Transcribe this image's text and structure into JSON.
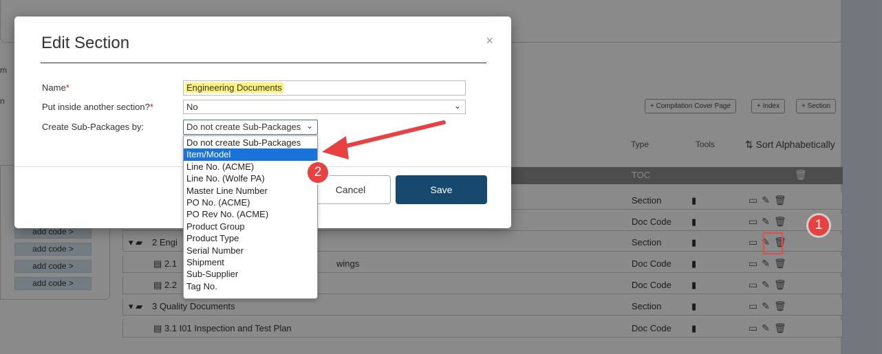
{
  "background": {
    "cut_labels": [
      "m",
      "n"
    ],
    "buttons": [
      "+ Compilation Cover Page",
      "+ Index",
      "+ Section"
    ],
    "table_headers": {
      "type": "Type",
      "tools": "Tools",
      "sort": "Sort Alphabetically"
    },
    "rows": [
      {
        "label": "",
        "type": "TOC"
      },
      {
        "label": "",
        "type": "Section"
      },
      {
        "label": "",
        "type": "Doc Code"
      },
      {
        "label": "2  Engi",
        "type": "Section"
      },
      {
        "label": "2.1",
        "label_tail": "wings",
        "type": "Doc Code"
      },
      {
        "label": "2.2",
        "type": "Doc Code"
      },
      {
        "label": "3  Quality Documents",
        "type": "Section"
      },
      {
        "label": "3.1  I01 Inspection and Test Plan",
        "type": "Doc Code"
      }
    ],
    "code_pills": [
      "add code >",
      "add code >",
      "add code >",
      "add code >"
    ]
  },
  "modal": {
    "title": "Edit Section",
    "close": "×",
    "fields": {
      "name_label": "Name",
      "name_value": "Engineering Documents",
      "parent_label": "Put inside another section?",
      "parent_value": "No",
      "sub_label": "Create Sub-Packages by:",
      "sub_value": "Do not create Sub-Packages"
    },
    "required_mark": "*",
    "cancel": "Cancel",
    "save": "Save"
  },
  "dropdown": {
    "options": [
      "Do not create Sub-Packages",
      "Item/Model",
      "Line No. (ACME)",
      "Line No. (Wolfe PA)",
      "Master Line Number",
      "PO No. (ACME)",
      "PO Rev No. (ACME)",
      "Product Group",
      "Product Type",
      "Serial Number",
      "Shipment",
      "Sub-Supplier",
      "Tag No."
    ],
    "selected_index": 1
  },
  "annotations": {
    "badge1": "1",
    "badge2": "2"
  },
  "colors": {
    "accent": "#17496f",
    "highlight": "#fff27a",
    "annotation": "#e84141",
    "selected": "#1a73d9"
  }
}
